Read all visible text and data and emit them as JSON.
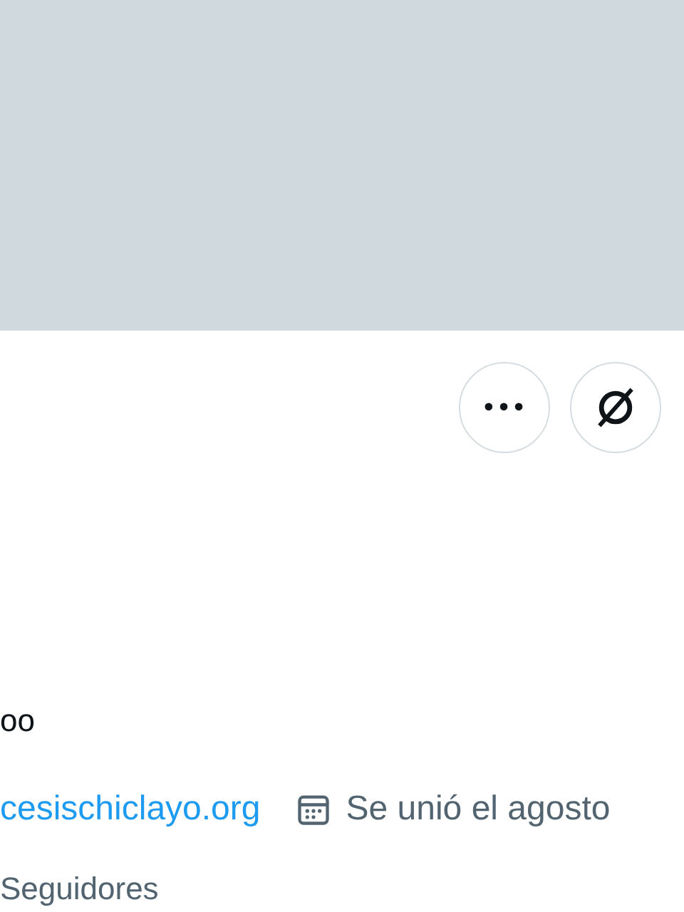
{
  "header_actions": [
    {
      "kind": "more",
      "label": "•••"
    },
    {
      "kind": "link-off"
    }
  ],
  "name_fragment": "oo",
  "website": "cesischiclayo.org",
  "joined": "Se unió el agosto",
  "followers_label": "Seguidores"
}
